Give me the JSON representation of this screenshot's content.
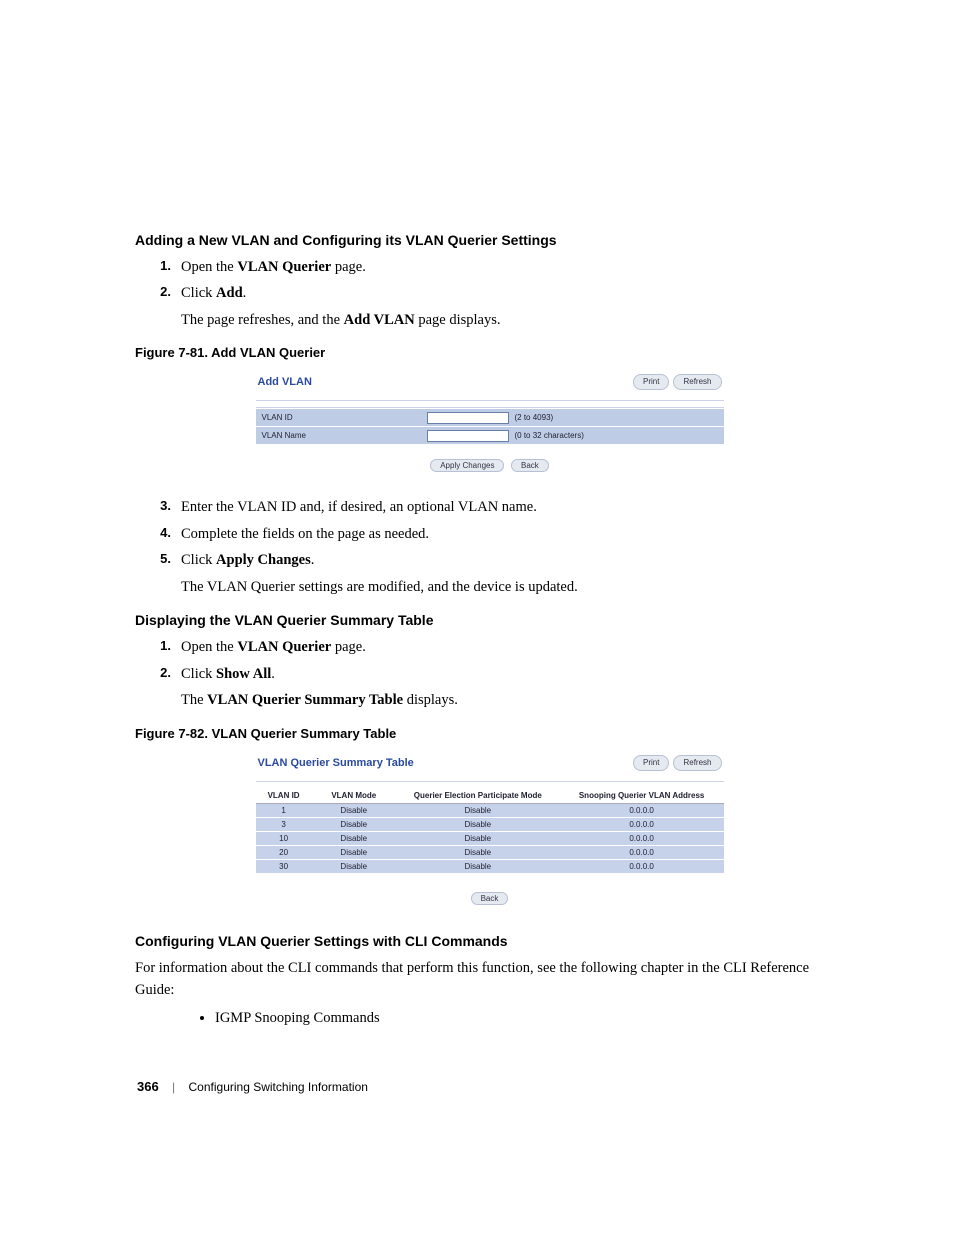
{
  "section1": {
    "heading": "Adding a New VLAN and Configuring its VLAN Querier Settings",
    "steps": [
      {
        "num": "1.",
        "pre": "Open the ",
        "bold": "VLAN Querier",
        "post": " page."
      },
      {
        "num": "2.",
        "pre": "Click ",
        "bold": "Add",
        "post": ".",
        "sub_pre": "The page refreshes, and the ",
        "sub_bold": "Add VLAN",
        "sub_post": " page displays."
      }
    ]
  },
  "fig1": {
    "caption": "Figure 7-81.    Add VLAN Querier",
    "title": "Add VLAN",
    "btn_print": "Print",
    "btn_refresh": "Refresh",
    "rows": [
      {
        "label": "VLAN ID",
        "hint": "(2 to 4093)"
      },
      {
        "label": "VLAN Name",
        "hint": "(0 to 32 characters)"
      }
    ],
    "btn_apply": "Apply Changes",
    "btn_back": "Back"
  },
  "section1b": {
    "steps": [
      {
        "num": "3.",
        "text": "Enter the VLAN ID and, if desired, an optional VLAN name."
      },
      {
        "num": "4.",
        "text": "Complete the fields on the page as needed."
      },
      {
        "num": "5.",
        "pre": "Click ",
        "bold": "Apply Changes",
        "post": ".",
        "sub": "The VLAN Querier settings are modified, and the device is updated."
      }
    ]
  },
  "section2": {
    "heading": "Displaying the VLAN Querier Summary Table",
    "steps": [
      {
        "num": "1.",
        "pre": "Open the ",
        "bold": "VLAN Querier",
        "post": " page."
      },
      {
        "num": "2.",
        "pre": "Click ",
        "bold": "Show All",
        "post": ".",
        "sub_pre": "The ",
        "sub_bold": "VLAN Querier Summary Table",
        "sub_post": " displays."
      }
    ]
  },
  "fig2": {
    "caption": "Figure 7-82.    VLAN Querier Summary Table",
    "title": "VLAN Querier Summary Table",
    "btn_print": "Print",
    "btn_refresh": "Refresh",
    "headers": [
      "VLAN ID",
      "VLAN Mode",
      "Querier Election Participate Mode",
      "Snooping Querier VLAN Address"
    ],
    "rows": [
      [
        "1",
        "Disable",
        "Disable",
        "0.0.0.0"
      ],
      [
        "3",
        "Disable",
        "Disable",
        "0.0.0.0"
      ],
      [
        "10",
        "Disable",
        "Disable",
        "0.0.0.0"
      ],
      [
        "20",
        "Disable",
        "Disable",
        "0.0.0.0"
      ],
      [
        "30",
        "Disable",
        "Disable",
        "0.0.0.0"
      ]
    ],
    "btn_back": "Back"
  },
  "section3": {
    "heading": "Configuring VLAN Querier Settings with CLI Commands",
    "para": "For information about the CLI commands that perform this function, see the following chapter in the CLI Reference Guide:",
    "bullets": [
      "IGMP Snooping Commands"
    ]
  },
  "footer": {
    "page": "366",
    "chapter": "Configuring Switching Information"
  }
}
